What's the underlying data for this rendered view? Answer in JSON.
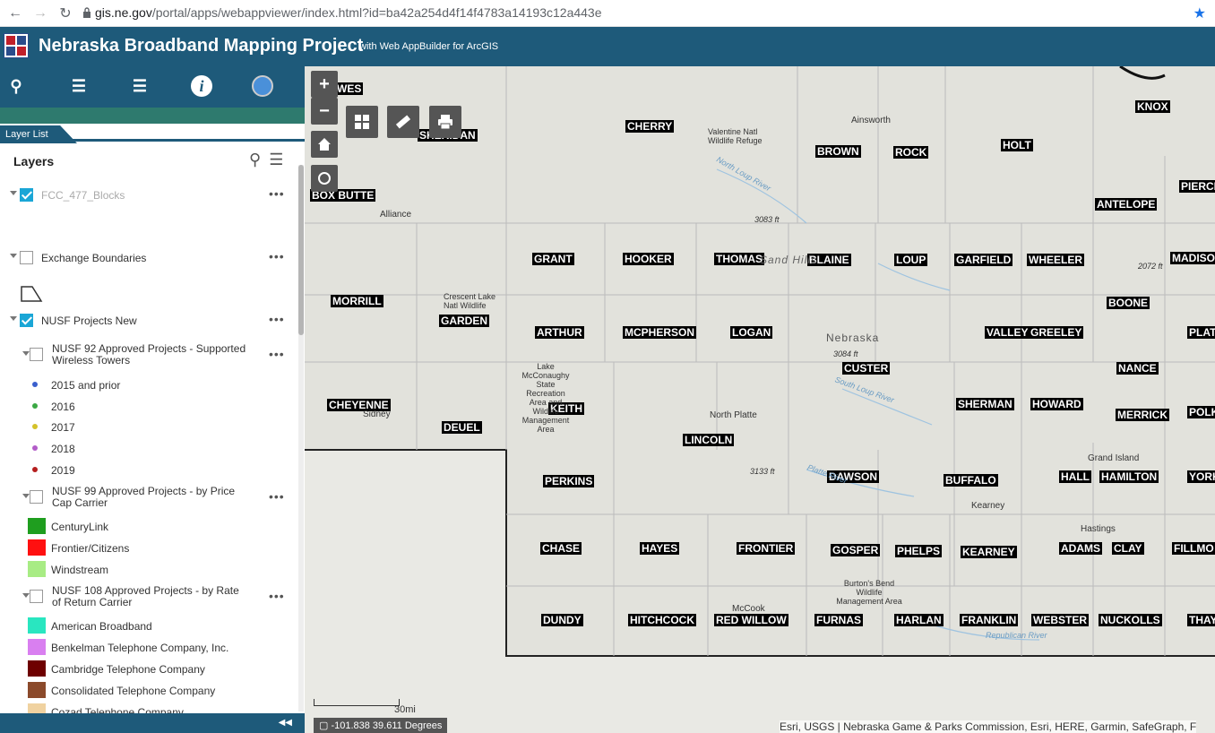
{
  "browser": {
    "url_host": "gis.ne.gov",
    "url_path": "/portal/apps/webappviewer/index.html?id=ba42a254d4f14f4783a14193c12a443e"
  },
  "app": {
    "title": "Nebraska Broadband Mapping Project",
    "subtitle": "with Web AppBuilder for ArcGIS"
  },
  "panel": {
    "tab_label": "Layer List",
    "header": "Layers",
    "layers": [
      {
        "label": "FCC_477_Blocks",
        "checked": true,
        "dim": true
      },
      {
        "label": "Exchange Boundaries",
        "checked": false
      },
      {
        "label": "NUSF Projects New",
        "checked": true
      }
    ],
    "sublayers": [
      {
        "label": "NUSF 92 Approved Projects - Supported Wireless Towers"
      },
      {
        "label": "NUSF 99 Approved Projects - by Price Cap Carrier"
      },
      {
        "label": "NUSF 108 Approved Projects - by Rate of Return Carrier"
      }
    ],
    "years": [
      "2015 and prior",
      "2016",
      "2017",
      "2018",
      "2019"
    ],
    "year_colors": [
      "#3a5fcd",
      "#3aa844",
      "#d4c22a",
      "#b25cc8",
      "#b51e1e"
    ],
    "price_cap": [
      "CenturyLink",
      "Frontier/Citizens",
      "Windstream"
    ],
    "price_cap_colors": [
      "#1f9e1f",
      "#ff1010",
      "#a8ec84"
    ],
    "ror": [
      "American Broadband",
      "Benkelman Telephone Company, Inc.",
      "Cambridge Telephone Company",
      "Consolidated Telephone Company",
      "Cozad Telephone Company"
    ],
    "ror_colors": [
      "#29e6c0",
      "#d97ff0",
      "#6e0000",
      "#8b4a2b",
      "#f0d2a0"
    ]
  },
  "map": {
    "coord": "-101.838 39.611 Degrees",
    "scale": "30mi",
    "attribution": "Esri, USGS | Nebraska Game & Parks Commission, Esri, HERE, Garmin, SafeGraph, F",
    "counties": [
      "WES",
      "SHERIDAN",
      "CHERRY",
      "KNOX",
      "BROWN",
      "ROCK",
      "HOLT",
      "BOX BUTTE",
      "PIERCE",
      "ANTELOPE",
      "GRANT",
      "HOOKER",
      "THOMAS",
      "BLAINE",
      "LOUP",
      "GARFIELD",
      "WHEELER",
      "MADISO",
      "MORRILL",
      "GARDEN",
      "BOONE",
      "ARTHUR",
      "MCPHERSON",
      "LOGAN",
      "VALLEY",
      "GREELEY",
      "PLAT",
      "CUSTER",
      "NANCE",
      "CHEYENNE",
      "KEITH",
      "SHERMAN",
      "HOWARD",
      "MERRICK",
      "POLK",
      "DEUEL",
      "LINCOLN",
      "PERKINS",
      "DAWSON",
      "BUFFALO",
      "HALL",
      "HAMILTON",
      "YORK",
      "CHASE",
      "HAYES",
      "FRONTIER",
      "GOSPER",
      "PHELPS",
      "KEARNEY",
      "ADAMS",
      "CLAY",
      "FILLMO",
      "DUNDY",
      "HITCHCOCK",
      "RED WILLOW",
      "FURNAS",
      "HARLAN",
      "FRANKLIN",
      "WEBSTER",
      "NUCKOLLS",
      "THAYE"
    ],
    "places": [
      "Ainsworth",
      "Valentine Natl Wildlife Refuge",
      "Alliance",
      "3083 ft",
      "Crescent Lake Natl Wildlife",
      "Nebraska",
      "3084 ft",
      "Lake McConaughy State Recreation Area and Wildlife Management Area",
      "Sidney",
      "North Platte",
      "3133 ft",
      "Grand Island",
      "Kearney",
      "Hastings",
      "Burton's Bend Wildlife Management Area",
      "McCook",
      "2072 ft",
      "North Loup River",
      "South Loup River",
      "Platte River",
      "Republican River",
      "Sand Hills"
    ]
  }
}
